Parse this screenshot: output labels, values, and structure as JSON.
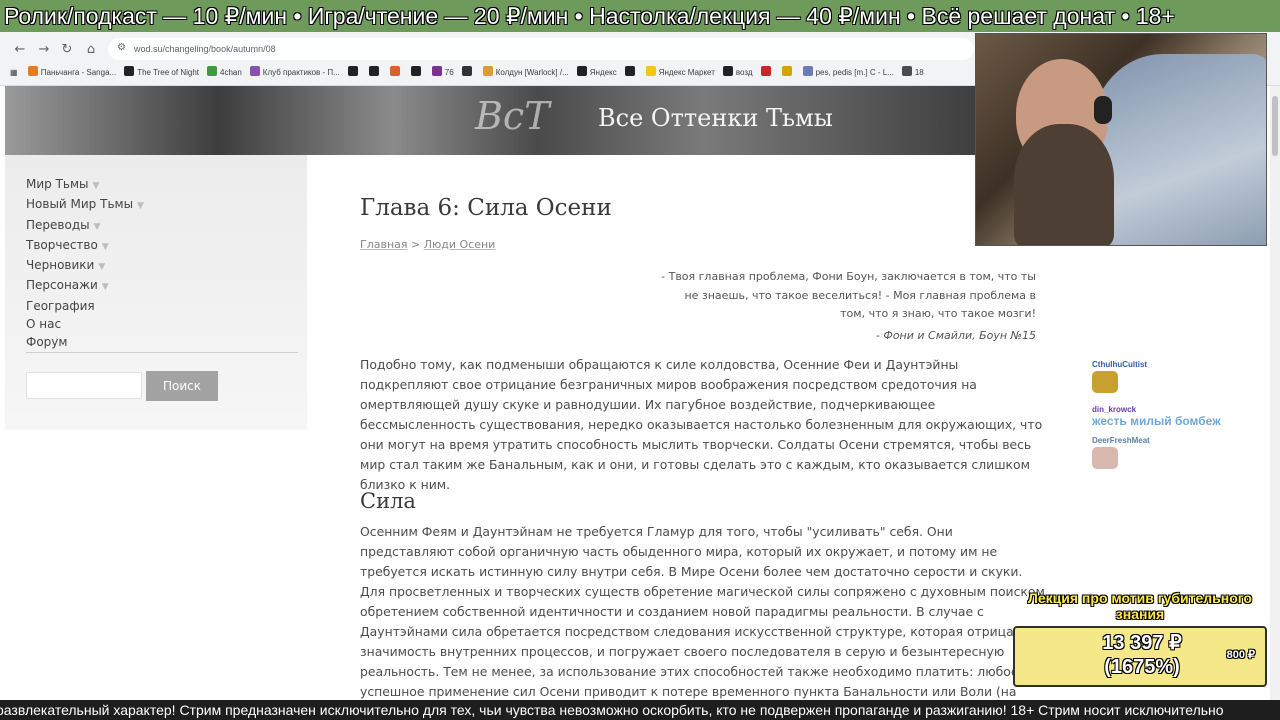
{
  "stream": {
    "top_ticker": "Ролик/подкаст — 10 ₽/мин • Игра/чтение — 20 ₽/мин • Настолка/лекция — 40 ₽/мин • Всё решает донат • 18+",
    "bottom_ticker": "развлекательный характер! Стрим предназначен исключительно для тех, чьи чувства невозможно оскорбить, кто не подвержен пропаганде и разжиганию! 18+ Стрим носит исключительно"
  },
  "browser": {
    "url": "wod.su/changeling/book/autumn/08",
    "bookmarks": [
      {
        "label": "Паньчанга - Sanga...",
        "color": "#e67c22"
      },
      {
        "label": "The Tree of Night",
        "color": "#222222"
      },
      {
        "label": "4chan",
        "color": "#3d9b3d"
      },
      {
        "label": "Клуб практиков - П...",
        "color": "#8a4fb5"
      },
      {
        "label": "",
        "color": "#222222"
      },
      {
        "label": "",
        "color": "#222222"
      },
      {
        "label": "",
        "color": "#d9632b"
      },
      {
        "label": "",
        "color": "#222222"
      },
      {
        "label": "76",
        "color": "#7b2f8e"
      },
      {
        "label": "",
        "color": "#333333"
      },
      {
        "label": "Колдун [Warlock] /...",
        "color": "#e09a2f"
      },
      {
        "label": "Яндекс",
        "color": "#222222"
      },
      {
        "label": "",
        "color": "#222222"
      },
      {
        "label": "Яндекс Маркет",
        "color": "#f5c518"
      },
      {
        "label": "возд",
        "color": "#222222"
      },
      {
        "label": "",
        "color": "#c62828"
      },
      {
        "label": "",
        "color": "#d6a300"
      },
      {
        "label": "pes, pedis [m.] C - L...",
        "color": "#6a7bb5"
      },
      {
        "label": "18",
        "color": "#4c4c4c"
      }
    ]
  },
  "site": {
    "logo": "ВсТ",
    "title": "Все Оттенки Тьмы"
  },
  "sidebar": {
    "items": [
      {
        "label": "Мир Тьмы",
        "arrow": "▼"
      },
      {
        "label": "Новый Мир Тьмы",
        "arrow": "▼"
      },
      {
        "label": "Переводы",
        "arrow": "▼"
      },
      {
        "label": "Творчество",
        "arrow": "▼"
      },
      {
        "label": "Черновики",
        "arrow": "▼"
      },
      {
        "label": "Персонажи",
        "arrow": "▼"
      },
      {
        "label": "География",
        "arrow": ""
      },
      {
        "label": "О нас",
        "arrow": ""
      },
      {
        "label": "Форум",
        "arrow": ""
      }
    ],
    "search_button": "Поиск"
  },
  "article": {
    "title": "Глава 6: Сила Осени",
    "breadcrumb": {
      "home": "Главная",
      "sep": " > ",
      "current": "Люди Осени"
    },
    "epigraph_lines": [
      "- Твоя главная проблема, Фони Боун, заключается в том, что ты",
      "не знаешь, что такое веселиться! - Моя главная проблема в",
      "том, что я знаю, что такое мозги!"
    ],
    "epigraph_source": "- Фони и Смайли, Боун №15",
    "paragraph1": "Подобно тому, как подменыши обращаются к силе колдовства, Осенние Феи и Даунтэйны подкрепляют свое отрицание безграничных миров воображения посредством средоточия на омертвляющей душу скуке и равнодушии. Их пагубное воздействие, подчеркивающее бессмысленность существования, нередко оказывается настолько болезненным для окружающих, что они могут на время утратить способность мыслить творчески. Солдаты Осени стремятся, чтобы весь мир стал таким же Банальным, как и они, и готовы сделать это с каждым, кто оказывается слишком близко к ним.",
    "section_title": "Сила",
    "paragraph2": "Осенним Феям и Даунтэйнам не требуется Гламур для того, чтобы \"усиливать\" себя. Они представляют собой органичную часть обыденного мира, который их окружает, и потому им не требуется искать истинную силу внутри себя. В Мире Осени более чем достаточно серости и скуки. Для просветленных и творческих существ обретение магической силы сопряжено с духовным поиском, обретением собственной идентичности и созданием новой парадигмы реальности. В случае с Даунтэйнами сила обретается посредством следования искусственной структуре, которая отрицает значимость внутренних процессов, и погружает своего последователя в серую и безынтересную реальность. Тем не менее, за использование этих способностей также необходимо платить: любое успешное применение сил Осени приводит к потере временного пункта Банальности или Воли (на усмотрение Рассказчика). Под"
  },
  "chat": [
    {
      "user": "CthulhuCultist",
      "user_color": "#2a5fb0",
      "text": "",
      "emote_color": "#c8a030"
    },
    {
      "user": "din_krowck",
      "user_color": "#6a3fa0",
      "text": "жесть милый бомбеж",
      "emote_color": ""
    },
    {
      "user": "DeerFreshMeat",
      "user_color": "#5a7fa0",
      "text": "",
      "emote_color": "#d9b8b0"
    }
  ],
  "donation_goal": {
    "label": "Лекция про мотив губительного знания",
    "amount": "13 397 ₽",
    "percent": "(1675%)",
    "target": "800 ₽",
    "progress_percent": 1675
  }
}
